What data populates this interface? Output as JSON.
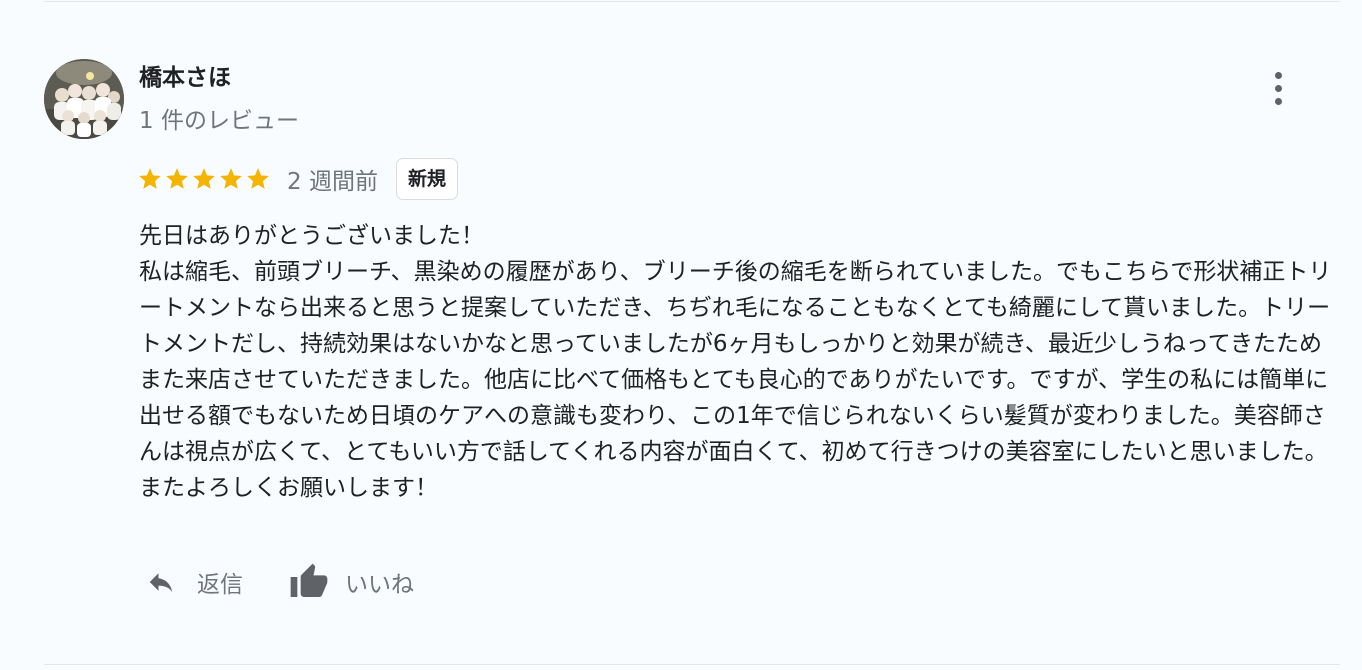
{
  "review": {
    "reviewer_name": "橋本さほ",
    "review_count": "1 件のレビュー",
    "rating": 5,
    "rating_max": 5,
    "time_ago": "2 週間前",
    "badge": "新規",
    "text": "先日はありがとうございました！\n私は縮毛、前頭ブリーチ、黒染めの履歴があり、ブリーチ後の縮毛を断られていました。でもこちらで形状補正トリートメントなら出来ると思うと提案していただき、ちぢれ毛になることもなくとても綺麗にして貰いました。トリートメントだし、持続効果はないかなと思っていましたが6ヶ月もしっかりと効果が続き、最近少しうねってきたためまた来店させていただきました。他店に比べて価格もとても良心的でありがたいです。ですが、学生の私には簡単に出せる額でもないため日頃のケアへの意識も変わり、この1年で信じられないくらい髪質が変わりました。美容師さんは視点が広くて、とてもいい方で話してくれる内容が面白くて、初めて行きつけの美容室にしたいと思いました。またよろしくお願いします！"
  },
  "actions": {
    "reply_label": "返信",
    "like_label": "いいね"
  },
  "icons": {
    "more": "more-vert-icon",
    "star": "star-icon",
    "reply": "reply-icon",
    "like": "thumb-up-icon"
  },
  "colors": {
    "star": "#f4b400",
    "secondary_text": "#70757a",
    "icon": "#5f6368",
    "background": "#f8fcff"
  }
}
